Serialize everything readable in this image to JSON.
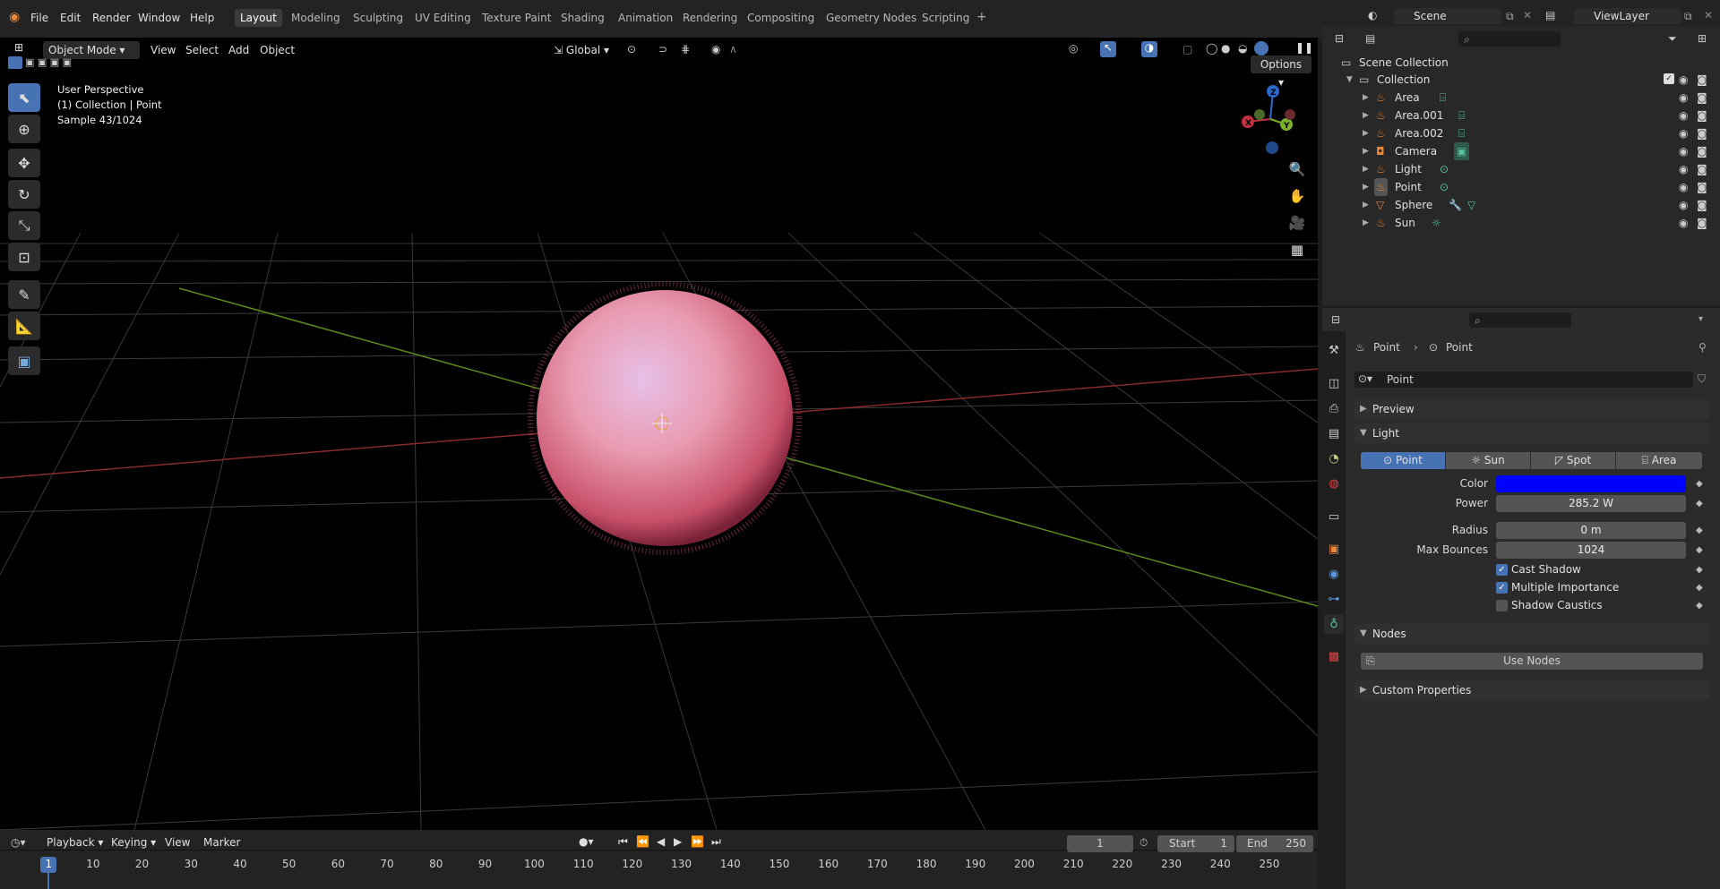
{
  "topbar": {
    "menus": [
      "File",
      "Edit",
      "Render",
      "Window",
      "Help"
    ],
    "workspaces": [
      "Layout",
      "Modeling",
      "Sculpting",
      "UV Editing",
      "Texture Paint",
      "Shading",
      "Animation",
      "Rendering",
      "Compositing",
      "Geometry Nodes",
      "Scripting"
    ],
    "active_workspace": "Layout",
    "scene": "Scene",
    "view_layer": "ViewLayer"
  },
  "viewport_header": {
    "mode": "Object Mode",
    "menus": [
      "View",
      "Select",
      "Add",
      "Object"
    ],
    "orientation": "Global",
    "options": "Options"
  },
  "viewport_overlay": {
    "perspective": "User Perspective",
    "collection": "(1) Collection | Point",
    "sample": "Sample 43/1024"
  },
  "gizmo": {
    "x": "X",
    "y": "Y",
    "z": "Z"
  },
  "outliner": {
    "scene_collection": "Scene Collection",
    "collection": "Collection",
    "items": [
      {
        "name": "Area",
        "icon": "area-light-icon"
      },
      {
        "name": "Area.001",
        "icon": "area-light-icon"
      },
      {
        "name": "Area.002",
        "icon": "area-light-icon"
      },
      {
        "name": "Camera",
        "icon": "camera-data-icon"
      },
      {
        "name": "Light",
        "icon": "point-light-icon"
      },
      {
        "name": "Point",
        "icon": "point-light-icon"
      },
      {
        "name": "Sphere",
        "icon": "mesh-icon"
      },
      {
        "name": "Sun",
        "icon": "sun-light-icon"
      }
    ]
  },
  "properties": {
    "breadcrumb_obj": "Point",
    "breadcrumb_data": "Point",
    "datablock": "Point",
    "preview": "Preview",
    "light_panel": "Light",
    "light_types": [
      "Point",
      "Sun",
      "Spot",
      "Area"
    ],
    "active_type": "Point",
    "color_label": "Color",
    "color_value": "#0000ff",
    "power_label": "Power",
    "power_value": "285.2 W",
    "radius_label": "Radius",
    "radius_value": "0 m",
    "bounces_label": "Max Bounces",
    "bounces_value": "1024",
    "cast_shadow": "Cast Shadow",
    "multiple_importance": "Multiple Importance",
    "shadow_caustics": "Shadow Caustics",
    "nodes_panel": "Nodes",
    "use_nodes": "Use Nodes",
    "custom_props": "Custom Properties"
  },
  "timeline": {
    "menus": [
      "Playback",
      "Keying",
      "View",
      "Marker"
    ],
    "current_frame": "1",
    "start_label": "Start",
    "start": "1",
    "end_label": "End",
    "end": "250",
    "ticks": [
      "1",
      "10",
      "20",
      "30",
      "40",
      "50",
      "60",
      "70",
      "80",
      "90",
      "100",
      "110",
      "120",
      "130",
      "140",
      "150",
      "160",
      "170",
      "180",
      "190",
      "200",
      "210",
      "220",
      "230",
      "240",
      "250"
    ]
  }
}
